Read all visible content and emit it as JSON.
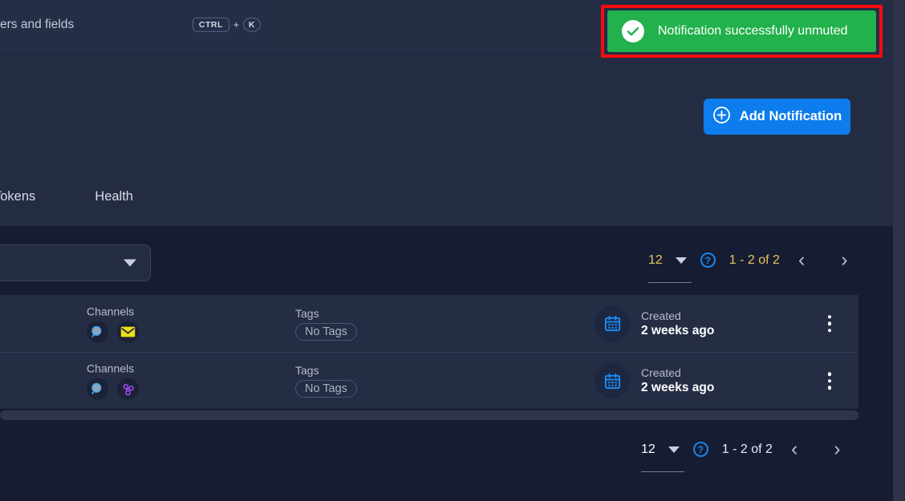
{
  "search": {
    "text": "ers and fields",
    "shortcut_modifier": "CTRL",
    "shortcut_plus": "+",
    "shortcut_key": "K"
  },
  "toast": {
    "message": "Notification successfully unmuted",
    "icon": "check-circle-icon",
    "background_color": "#22b14c",
    "highlight_color": "#f60c0c"
  },
  "actions": {
    "add_notification_label": "Add Notification",
    "add_notification_icon": "plus-circle-icon",
    "add_notification_color": "#0d7ded"
  },
  "tabs": [
    {
      "label": "Tokens"
    },
    {
      "label": "Health"
    }
  ],
  "filter": {
    "value": "",
    "caret_icon": "chevron-down-icon"
  },
  "pagination_top": {
    "page_size": "12",
    "help_icon": "question-mark-icon",
    "range": "1 - 2 of 2",
    "prev_icon": "chevron-left-icon",
    "next_icon": "chevron-right-icon"
  },
  "pagination_bottom": {
    "page_size": "12",
    "help_icon": "question-mark-icon",
    "range": "1 - 2 of 2",
    "prev_icon": "chevron-left-icon",
    "next_icon": "chevron-right-icon"
  },
  "table": {
    "rows": [
      {
        "channels_label": "Channels",
        "channel_icons": [
          "search-icon",
          "email-icon"
        ],
        "tags_label": "Tags",
        "tags_value": "No Tags",
        "created_label": "Created",
        "created_value": "2 weeks ago",
        "calendar_icon": "calendar-icon",
        "menu_icon": "kebab-menu-icon"
      },
      {
        "channels_label": "Channels",
        "channel_icons": [
          "search-icon",
          "webhook-icon"
        ],
        "tags_label": "Tags",
        "tags_value": "No Tags",
        "created_label": "Created",
        "created_value": "2 weeks ago",
        "calendar_icon": "calendar-icon",
        "menu_icon": "kebab-menu-icon"
      }
    ]
  },
  "colors": {
    "page_background": "#242c44",
    "panel_background": "#161d33",
    "row_background": "#242d44",
    "accent_blue": "#0d7ded",
    "email_yellow": "#e8e018",
    "webhook_purple": "#9b4df0",
    "gold_text": "#e8c35a"
  }
}
